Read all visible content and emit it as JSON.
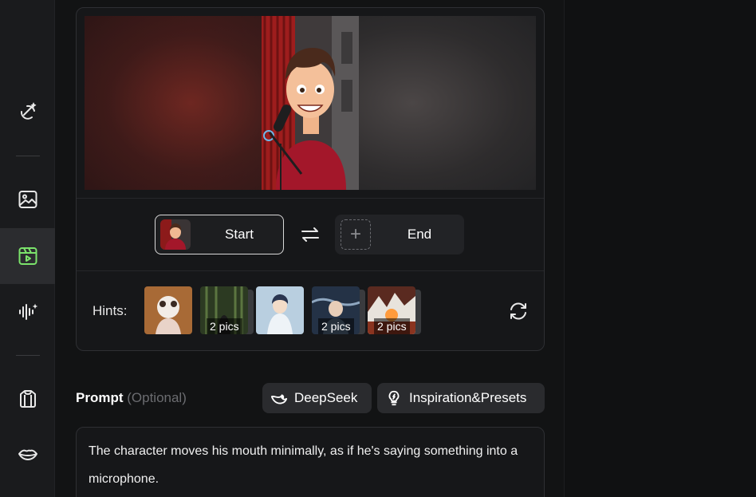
{
  "sidebar": {
    "items": [
      {
        "icon": "magic-wand-icon"
      },
      {
        "icon": "image-icon"
      },
      {
        "icon": "video-icon",
        "active": true
      },
      {
        "icon": "audio-wave-icon"
      },
      {
        "icon": "shirt-icon"
      },
      {
        "icon": "lips-icon"
      }
    ],
    "accent": "#7be36b"
  },
  "frames": {
    "start_label": "Start",
    "end_label": "End"
  },
  "hints": {
    "label": "Hints:",
    "items": [
      {
        "caption": ""
      },
      {
        "caption": "2 pics"
      },
      {
        "caption": ""
      },
      {
        "caption": "2 pics"
      },
      {
        "caption": "2 pics"
      }
    ]
  },
  "prompt": {
    "title": "Prompt",
    "optional": "(Optional)",
    "deepseek_label": "DeepSeek",
    "inspiration_label": "Inspiration&Presets",
    "text": "The character moves his mouth minimally, as if he's saying something into a microphone."
  }
}
